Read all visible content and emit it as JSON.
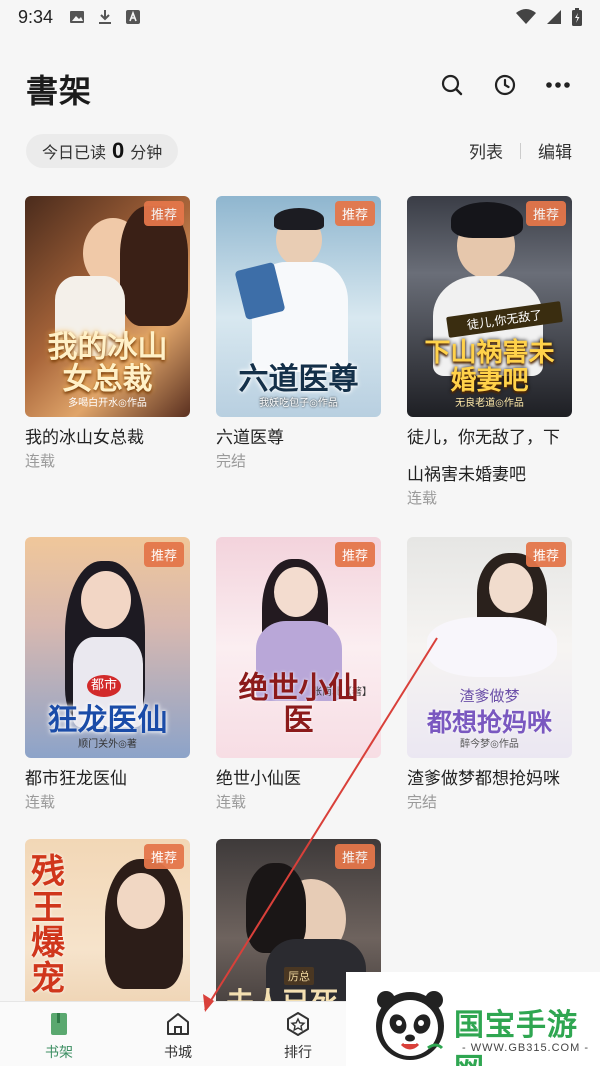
{
  "status_bar": {
    "time": "9:34",
    "left_icons": [
      "image-icon",
      "download-icon",
      "a-box-icon"
    ],
    "right_icons": [
      "wifi-icon",
      "signal-icon",
      "battery-icon"
    ]
  },
  "header": {
    "title": "書架",
    "actions": [
      "search-icon",
      "history-icon",
      "more-icon"
    ]
  },
  "reading": {
    "prefix": "今日已读",
    "minutes": "0",
    "suffix": "分钟"
  },
  "view_toggle": {
    "list_label": "列表",
    "edit_label": "编辑"
  },
  "badge_label": "推荐",
  "books": [
    {
      "title": "我的冰山女总裁",
      "status": "连载",
      "cover_title": "我的冰山女总裁",
      "cover_author": "多喝白开水◎作品"
    },
    {
      "title": "六道医尊",
      "status": "完结",
      "cover_title": "六道医尊",
      "cover_author": "我妖吃包子◎作品"
    },
    {
      "title": "徒儿，你无敌了，下山祸害未婚妻吧",
      "status": "连载",
      "cover_title": "下山祸害未婚妻吧",
      "cover_subtitle": "徒儿,你无敌了",
      "cover_author": "无良老道◎作品"
    },
    {
      "title": "都市狂龙医仙",
      "status": "连载",
      "cover_title": "狂龙医仙",
      "cover_subtitle": "都市",
      "cover_author": "顺门关外◎著"
    },
    {
      "title": "绝世小仙医",
      "status": "连载",
      "cover_title": "绝世小仙医",
      "cover_author": "张南北【著】"
    },
    {
      "title": "渣爹做梦都想抢妈咪",
      "status": "完结",
      "cover_title": "都想抢妈咪",
      "cover_subtitle": "渣爹做梦",
      "cover_author": "醉今梦◎作品"
    },
    {
      "title": "",
      "status": "",
      "cover_title": "残王爆宠",
      "cover_author": ""
    },
    {
      "title": "",
      "status": "",
      "cover_title": "夫人已死",
      "cover_subtitle": "厉总",
      "cover_author": ""
    }
  ],
  "tabs": [
    {
      "label": "书架",
      "icon": "bookshelf-icon",
      "active": true
    },
    {
      "label": "书城",
      "icon": "home-icon",
      "active": false
    },
    {
      "label": "排行",
      "icon": "rank-star-icon",
      "active": false
    }
  ],
  "watermark": {
    "brand": "国宝手游网",
    "url": "- WWW.GB315.COM -"
  },
  "colors": {
    "accent_green": "#3d8f63",
    "badge": "#e4774a",
    "annotation_arrow": "#d9403a"
  }
}
